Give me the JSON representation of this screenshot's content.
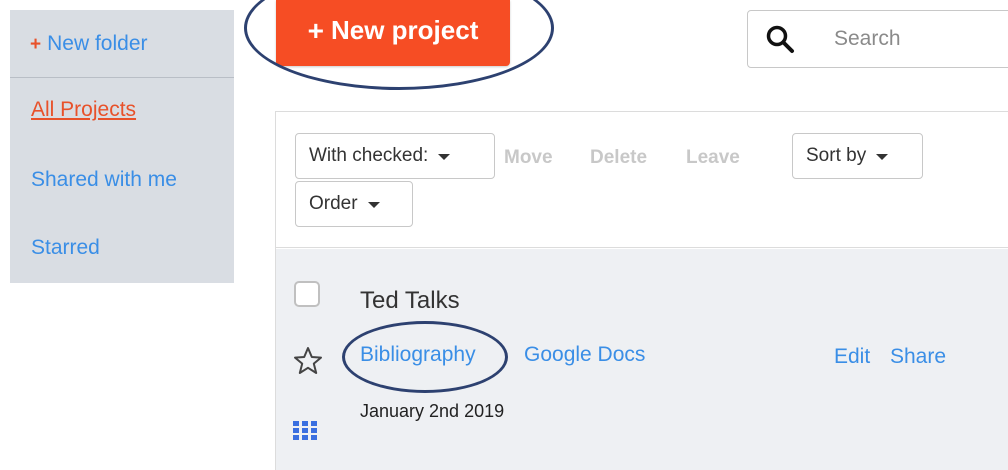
{
  "sidebar": {
    "new_folder": {
      "plus": "+",
      "label": "New folder"
    },
    "items": [
      {
        "label": "All Projects",
        "active": true
      },
      {
        "label": "Shared with me",
        "active": false
      },
      {
        "label": "Starred",
        "active": false
      }
    ]
  },
  "header": {
    "new_project": {
      "plus": "+",
      "label": "New project"
    },
    "search": {
      "placeholder": "Search",
      "icon": "search-icon"
    }
  },
  "toolbar": {
    "with_checked": "With checked:",
    "move": "Move",
    "delete": "Delete",
    "leave": "Leave",
    "sort_by": "Sort by",
    "order": "Order"
  },
  "projects": [
    {
      "title": "Ted Talks",
      "tags": [
        "Bibliography",
        "Google Docs"
      ],
      "date": "January 2nd 2019",
      "actions": {
        "edit": "Edit",
        "share": "Share"
      }
    }
  ],
  "colors": {
    "accent_orange": "#f64d24",
    "link_blue": "#3a8ee6",
    "sidebar_bg": "#d9dde3",
    "annotation_navy": "#2d4170"
  }
}
